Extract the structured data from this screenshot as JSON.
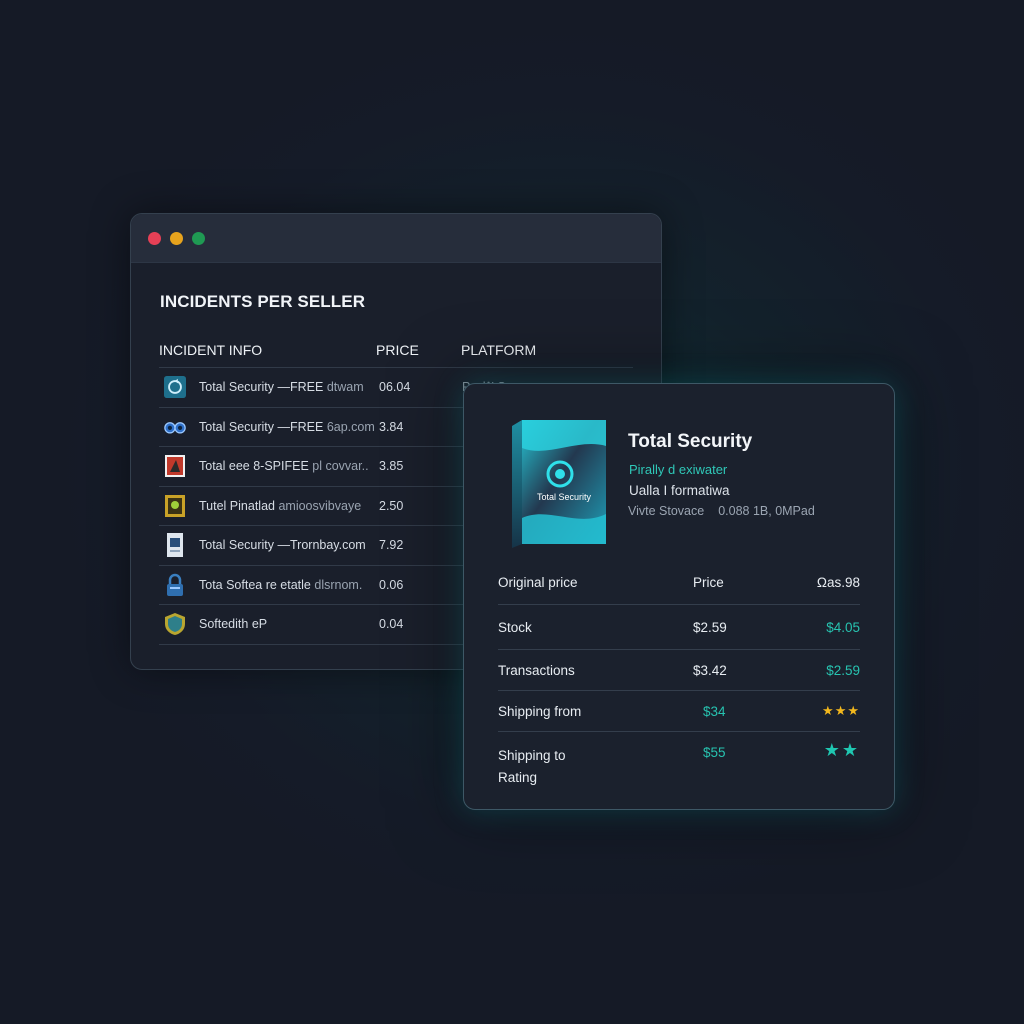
{
  "back_window": {
    "controls": {
      "close_color": "#e64056",
      "minimize_color": "#e7a31d",
      "maximize_color": "#1f9a53"
    },
    "title": "INCIDENTS PER SELLER",
    "columns": {
      "info": "INCIDENT INFO",
      "price": "PRICE",
      "platform": "PLATFORM"
    },
    "rows": [
      {
        "icon": "refresh-circle-icon",
        "info_main": "Total Security —FREE",
        "info_dim": "dtwam",
        "price": "06.04",
        "platform": "Prrd^' S"
      },
      {
        "icon": "binoculars-icon",
        "info_main": "Total Security —FREE",
        "info_dim": "6ap.com",
        "price": "3.84",
        "platform": "I"
      },
      {
        "icon": "software-box-icon",
        "info_main": "Total eee 8-SPIFEE",
        "info_dim": "pl covvar..",
        "price": "3.85",
        "platform": "I"
      },
      {
        "icon": "badge-icon",
        "info_main": "Tutel Pinatlad",
        "info_dim": "amioosvibvaye",
        "price": "2.50",
        "platform": "I"
      },
      {
        "icon": "document-icon",
        "info_main": "Total Security —Trornbay.com",
        "info_dim": "",
        "price": "7.92",
        "platform": "I"
      },
      {
        "icon": "lock-icon",
        "info_main": "Tota Softea re etatle",
        "info_dim": "dlsrnom.",
        "price": "0.06",
        "platform": "I"
      },
      {
        "icon": "shield-icon",
        "info_main": "Softedith eP",
        "info_dim": "",
        "price": "0.04",
        "platform": "I"
      }
    ]
  },
  "product_card": {
    "name": "Total Security",
    "box_label": "Total Security",
    "subtitle1": "Pirally d exiwater",
    "subtitle2": "Ualla I  formatiwa",
    "meta_left": "Vivte Stovace",
    "meta_right": "0.088 1B, 0MPad",
    "specs": [
      {
        "label": "Original price",
        "col2": "Price",
        "col3": "Ωas.98"
      },
      {
        "label": "Stock",
        "col2": "$2.59",
        "col3": "$4.05"
      },
      {
        "label": "Transactions",
        "col2": "$3.42",
        "col3": "$2.59"
      },
      {
        "label": "Shipping from",
        "col2": "$34",
        "stars": 3
      },
      {
        "label": "Shipping to",
        "label2": "Rating",
        "col2": "$55",
        "stars": 2
      }
    ],
    "accent_color": "#27c3b0",
    "star_gold": "#f3b81d"
  }
}
